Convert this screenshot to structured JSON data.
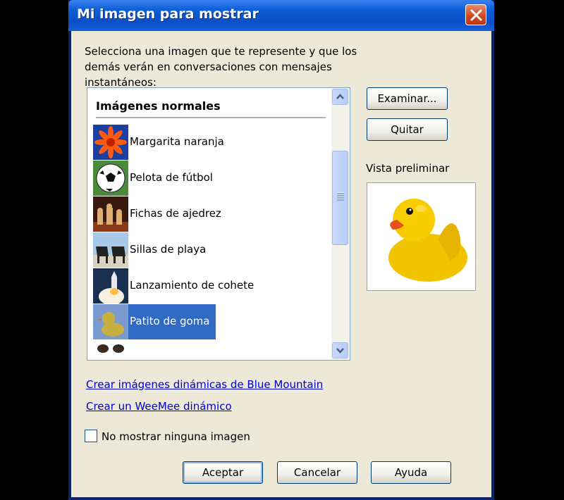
{
  "window": {
    "title": "Mi imagen para mostrar",
    "intro_text": "Selecciona una imagen que te represente y que los demás verán en conversaciones con mensajes instantáneos:"
  },
  "list": {
    "header": "Imágenes normales",
    "items": [
      {
        "label": "Margarita naranja",
        "icon": "orange-daisy-icon"
      },
      {
        "label": "Pelota de fútbol",
        "icon": "soccer-ball-icon"
      },
      {
        "label": "Fichas de ajedrez",
        "icon": "chess-pieces-icon"
      },
      {
        "label": "Sillas de playa",
        "icon": "beach-chairs-icon"
      },
      {
        "label": "Lanzamiento de cohete",
        "icon": "rocket-launch-icon"
      },
      {
        "label": "Patito de goma",
        "icon": "rubber-duck-icon",
        "selected": true
      }
    ]
  },
  "buttons": {
    "browse": "Examinar...",
    "remove": "Quitar",
    "ok": "Aceptar",
    "cancel": "Cancelar",
    "help": "Ayuda"
  },
  "preview": {
    "label": "Vista preliminar",
    "image": "rubber-duck-icon"
  },
  "links": {
    "blue_mountain": "Crear imágenes dinámicas de Blue Mountain",
    "weemee": "Crear un WeeMee dinámico"
  },
  "checkbox": {
    "label": "No mostrar ninguna imagen",
    "checked": false
  },
  "colors": {
    "titlebar": "#0a4fc8",
    "dialog_bg": "#ece9d8",
    "selection": "#316ac5",
    "link": "#0000d0"
  }
}
